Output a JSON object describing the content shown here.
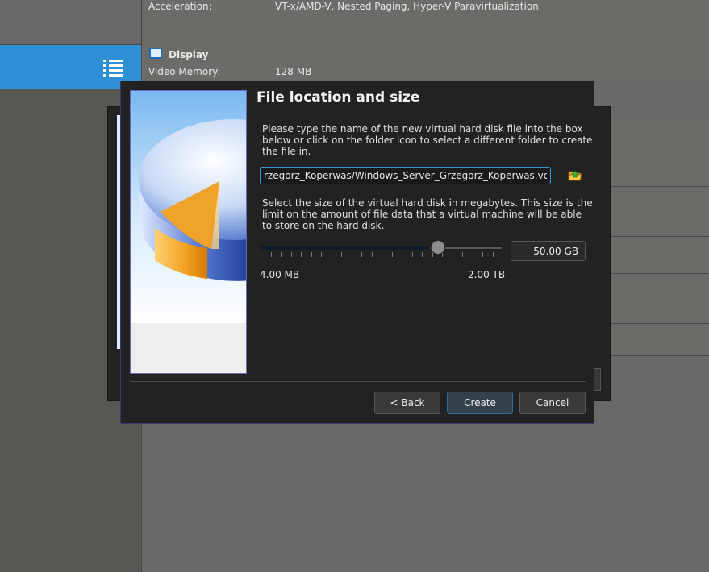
{
  "background": {
    "details": {
      "acceleration_label": "Acceleration:",
      "acceleration_value": "VT-x/AMD-V, Nested Paging, Hyper-V Paravirtualization",
      "display_title": "Display",
      "video_memory_label": "Video Memory:",
      "video_memory_value": "128 MB"
    },
    "selected_item_icon": "menu-list-icon"
  },
  "dialog": {
    "title": "File location and size",
    "location_instruction": "Please type the name of the new virtual hard disk file into the box below or click on the folder icon to select a different folder to create the file in.",
    "file_path": "rzegorz_Koperwas/Windows_Server_Grzegorz_Koperwas.vdi",
    "folder_icon": "folder-open-icon",
    "size_instruction": "Select the size of the virtual hard disk in megabytes. This size is the limit on the amount of file data that a virtual machine will be able to store on the hard disk.",
    "slider": {
      "min_label": "4.00 MB",
      "max_label": "2.00 TB",
      "position_fraction": 0.7
    },
    "size_value": "50.00 GB",
    "buttons": {
      "back": "< Back",
      "create": "Create",
      "cancel": "Cancel"
    }
  },
  "colors": {
    "selection": "#2f8fd4",
    "focus_border": "#2e9bd6",
    "dialog_bg": "#232223"
  }
}
